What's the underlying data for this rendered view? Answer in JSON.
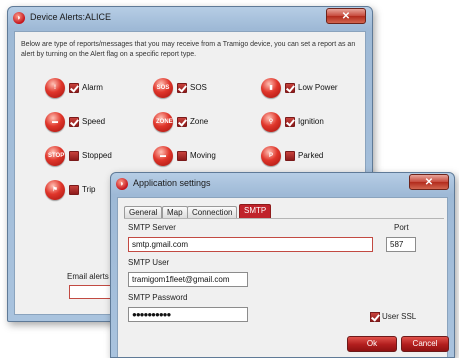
{
  "alerts_window": {
    "title": "Device Alerts:ALICE",
    "close_symbol": "✕",
    "description": "Below are type of reports/messages that you may receive from a Tramigo device, you can set a report as an alert by turning on the Alert flag on a specific report type.",
    "items": [
      {
        "label": "Alarm",
        "checked": true,
        "icon": "alarm-icon",
        "glyph": "!"
      },
      {
        "label": "SOS",
        "checked": true,
        "icon": "sos-icon",
        "glyph": "SOS"
      },
      {
        "label": "Low Power",
        "checked": true,
        "icon": "low-power-icon",
        "glyph": "▮"
      },
      {
        "label": "Speed",
        "checked": true,
        "icon": "speed-icon",
        "glyph": "▬"
      },
      {
        "label": "Zone",
        "checked": true,
        "icon": "zone-icon",
        "glyph": "ZONE"
      },
      {
        "label": "Ignition",
        "checked": true,
        "icon": "ignition-icon",
        "glyph": "⚲"
      },
      {
        "label": "Stopped",
        "checked": false,
        "icon": "stop-icon",
        "glyph": "STOP"
      },
      {
        "label": "Moving",
        "checked": false,
        "icon": "moving-icon",
        "glyph": "▬"
      },
      {
        "label": "Parked",
        "checked": false,
        "icon": "parked-icon",
        "glyph": "P"
      },
      {
        "label": "Trip",
        "checked": false,
        "icon": "trip-icon",
        "glyph": "⚑"
      }
    ],
    "email_label": "Email alerts",
    "email_value": ""
  },
  "settings_window": {
    "title": "Application settings",
    "close_symbol": "✕",
    "tabs": [
      "General",
      "Map",
      "Connection",
      "SMTP"
    ],
    "active_tab": "SMTP",
    "smtp_server_label": "SMTP Server",
    "smtp_server_value": "smtp.gmail.com",
    "port_label": "Port",
    "port_value": "587",
    "smtp_user_label": "SMTP User",
    "smtp_user_value": "tramigom1fleet@gmail.com",
    "smtp_password_label": "SMTP Password",
    "smtp_password_value": "●●●●●●●●●●",
    "use_ssl_label": "User SSL",
    "use_ssl_checked": true,
    "ok_label": "Ok",
    "cancel_label": "Cancel"
  },
  "colors": {
    "accent_red": "#c0232b",
    "window_frame": "#9eb9d6",
    "client_bg": "#f0f0f0"
  }
}
